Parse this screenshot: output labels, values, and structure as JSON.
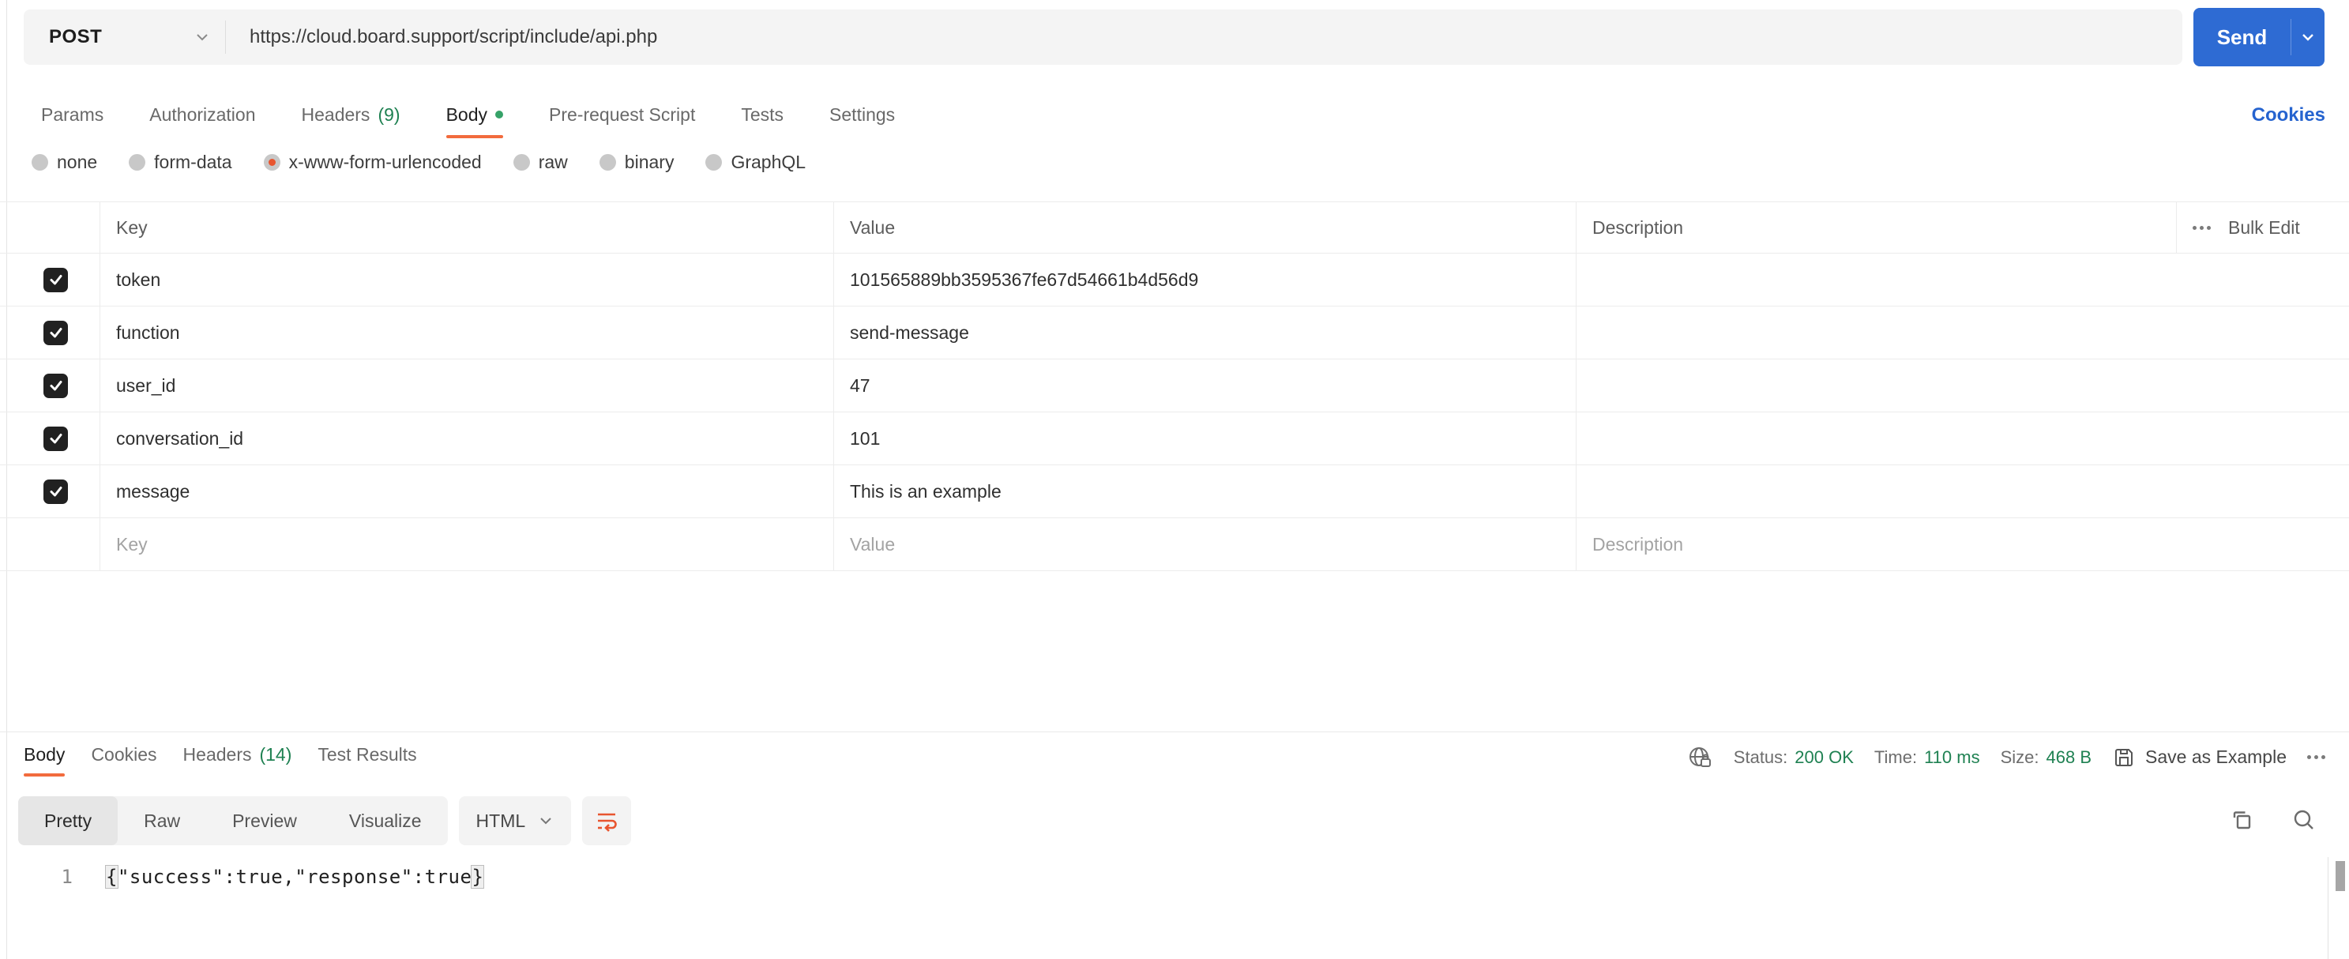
{
  "request": {
    "method": "POST",
    "url": "https://cloud.board.support/script/include/api.php",
    "send_label": "Send",
    "cookies_link": "Cookies",
    "tabs": [
      {
        "label": "Params"
      },
      {
        "label": "Authorization"
      },
      {
        "label": "Headers",
        "count": "(9)"
      },
      {
        "label": "Body"
      },
      {
        "label": "Pre-request Script"
      },
      {
        "label": "Tests"
      },
      {
        "label": "Settings"
      }
    ],
    "active_tab": "Body",
    "body_types": [
      "none",
      "form-data",
      "x-www-form-urlencoded",
      "raw",
      "binary",
      "GraphQL"
    ],
    "selected_body_type": "x-www-form-urlencoded",
    "table": {
      "headers": {
        "key": "Key",
        "value": "Value",
        "description": "Description"
      },
      "bulk_edit_label": "Bulk Edit",
      "rows": [
        {
          "key": "token",
          "value": "101565889bb3595367fe67d54661b4d56d9",
          "description": "",
          "checked": true
        },
        {
          "key": "function",
          "value": "send-message",
          "description": "",
          "checked": true
        },
        {
          "key": "user_id",
          "value": "47",
          "description": "",
          "checked": true
        },
        {
          "key": "conversation_id",
          "value": "101",
          "description": "",
          "checked": true
        },
        {
          "key": "message",
          "value": "This is an example",
          "description": "",
          "checked": true
        }
      ],
      "placeholders": {
        "key": "Key",
        "value": "Value",
        "description": "Description"
      }
    }
  },
  "response": {
    "tabs": [
      {
        "label": "Body"
      },
      {
        "label": "Cookies"
      },
      {
        "label": "Headers",
        "count": "(14)"
      },
      {
        "label": "Test Results"
      }
    ],
    "active_tab": "Body",
    "meta": {
      "status_label": "Status:",
      "status_value": "200 OK",
      "time_label": "Time:",
      "time_value": "110 ms",
      "size_label": "Size:",
      "size_value": "468 B",
      "save_as_example_label": "Save as Example"
    },
    "view_tabs": [
      "Pretty",
      "Raw",
      "Preview",
      "Visualize"
    ],
    "active_view_tab": "Pretty",
    "format_selector": "HTML",
    "body": {
      "line_number": "1",
      "open_brace": "{",
      "content": "\"success\":true,\"response\":true",
      "close_brace": "}"
    }
  },
  "colors": {
    "accent_orange": "#f26b3d",
    "send_button_blue": "#2e6bd3",
    "link_blue": "#2563cf",
    "success_green": "#1f8152",
    "unsaved_dot_green": "#36a268",
    "checkbox_dark": "#212121"
  }
}
